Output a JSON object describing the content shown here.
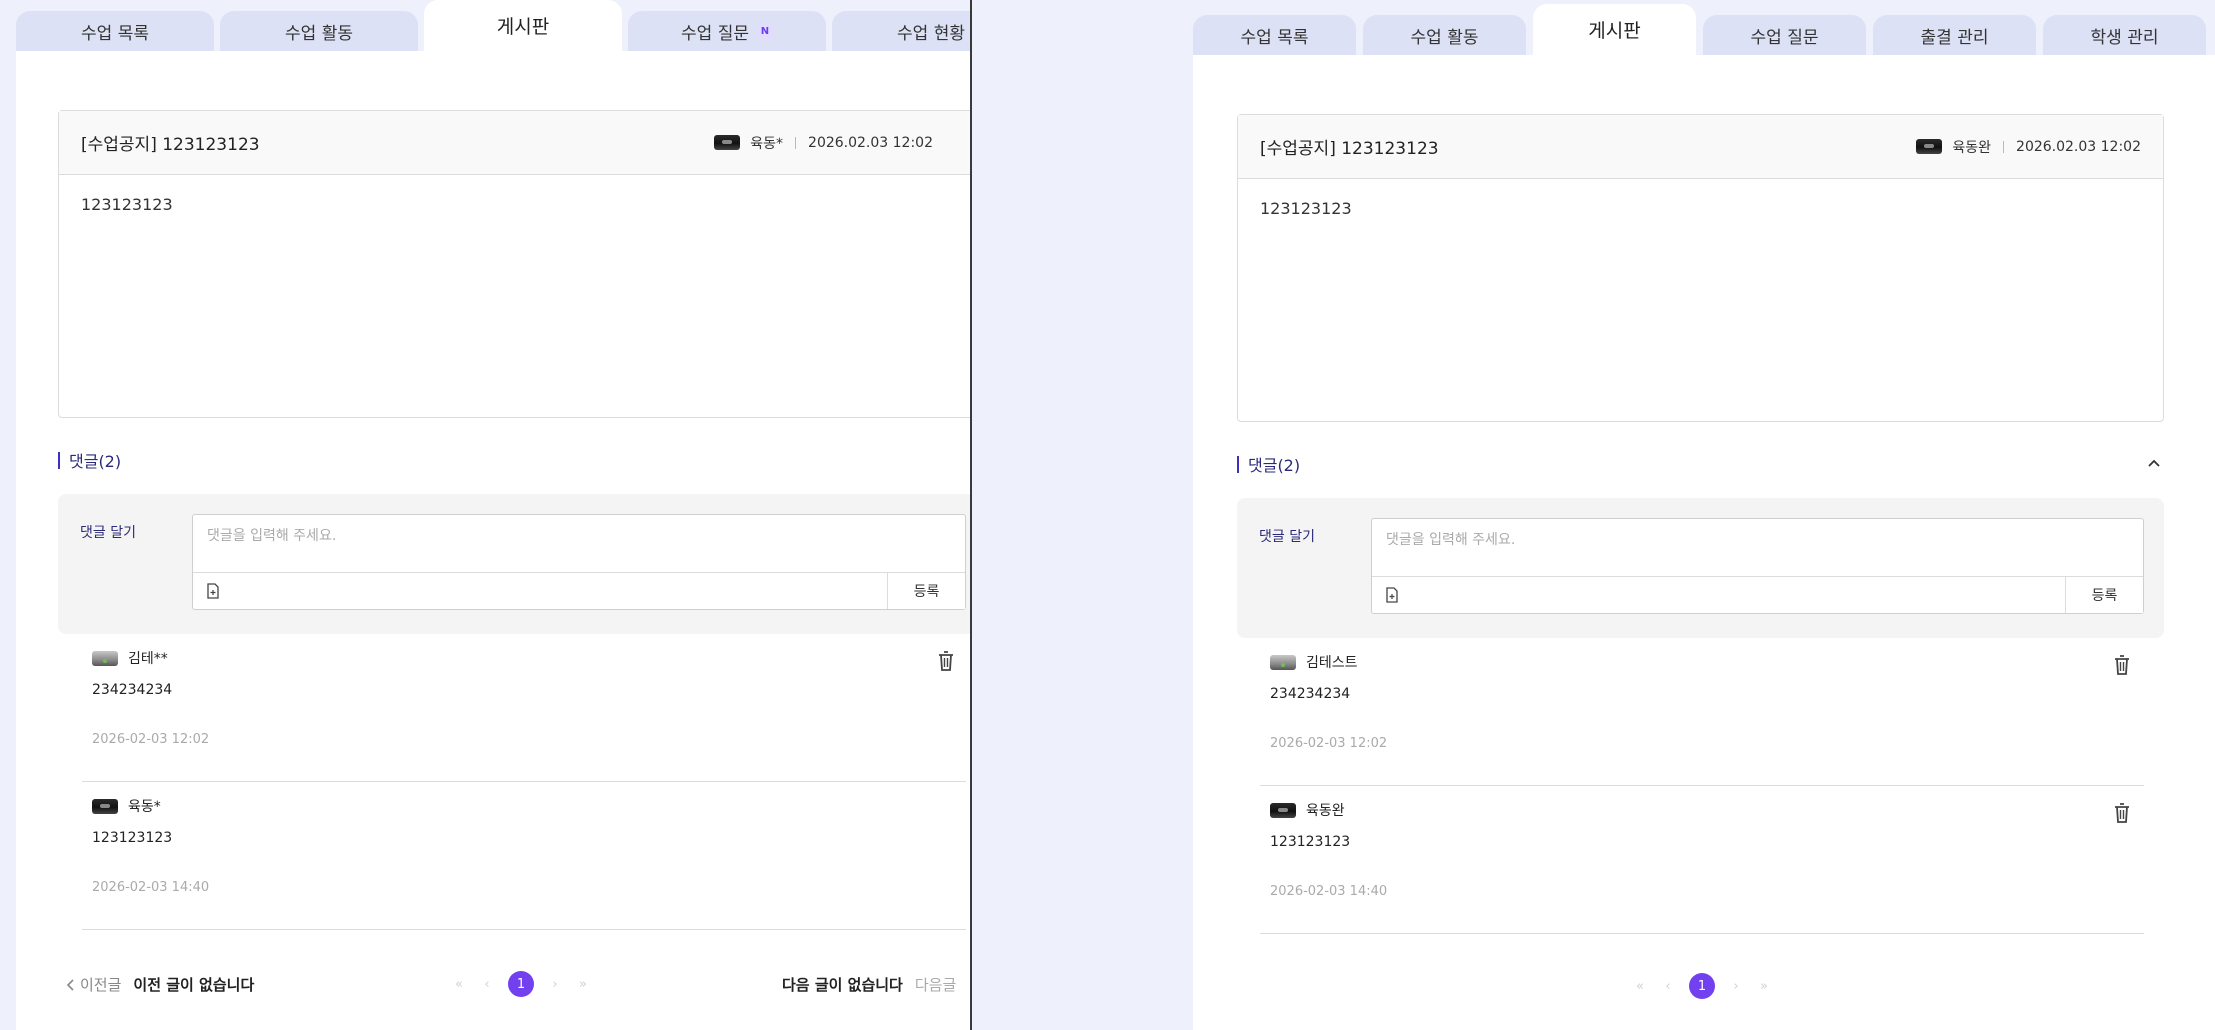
{
  "tabs": [
    {
      "label": "수업 목록"
    },
    {
      "label": "수업 활동"
    },
    {
      "label": "게시판"
    },
    {
      "label": "수업 질문",
      "badge": "N"
    },
    {
      "label": "수업 현황"
    },
    {
      "label": "출결 관리"
    },
    {
      "label": "학생 관리"
    }
  ],
  "left": {
    "post": {
      "title": "[수업공지] 123123123",
      "author": "육동*",
      "date": "2026.02.03 12:02",
      "body": "123123123"
    },
    "comments_title": "댓글(2)",
    "form": {
      "label": "댓글 달기",
      "placeholder": "댓글을 입력해 주세요.",
      "submit": "등록"
    },
    "comments": [
      {
        "author": "김테**",
        "text": "234234234",
        "time": "2026-02-03 12:02"
      },
      {
        "author": "육동*",
        "text": "123123123",
        "time": "2026-02-03 14:40"
      }
    ],
    "nav": {
      "prev_label": "이전글",
      "prev_value": "이전 글이 없습니다",
      "next_value": "다음 글이 없습니다",
      "next_label": "다음글"
    },
    "page": "1"
  },
  "right": {
    "post": {
      "title": "[수업공지] 123123123",
      "author": "육동완",
      "date": "2026.02.03 12:02",
      "body": "123123123"
    },
    "comments_title": "댓글(2)",
    "form": {
      "label": "댓글 달기",
      "placeholder": "댓글을 입력해 주세요.",
      "submit": "등록"
    },
    "comments": [
      {
        "author": "김테스트",
        "text": "234234234",
        "time": "2026-02-03 12:02"
      },
      {
        "author": "육동완",
        "text": "123123123",
        "time": "2026-02-03 14:40"
      }
    ],
    "page": "1"
  },
  "colors": {
    "accent": "#7340f0",
    "tab_bg": "#dde1f5",
    "page_bg": "#eef1fb"
  },
  "icons": {
    "attach": "file-icon",
    "trash": "trash-icon",
    "collapse": "chevron-up-icon"
  }
}
